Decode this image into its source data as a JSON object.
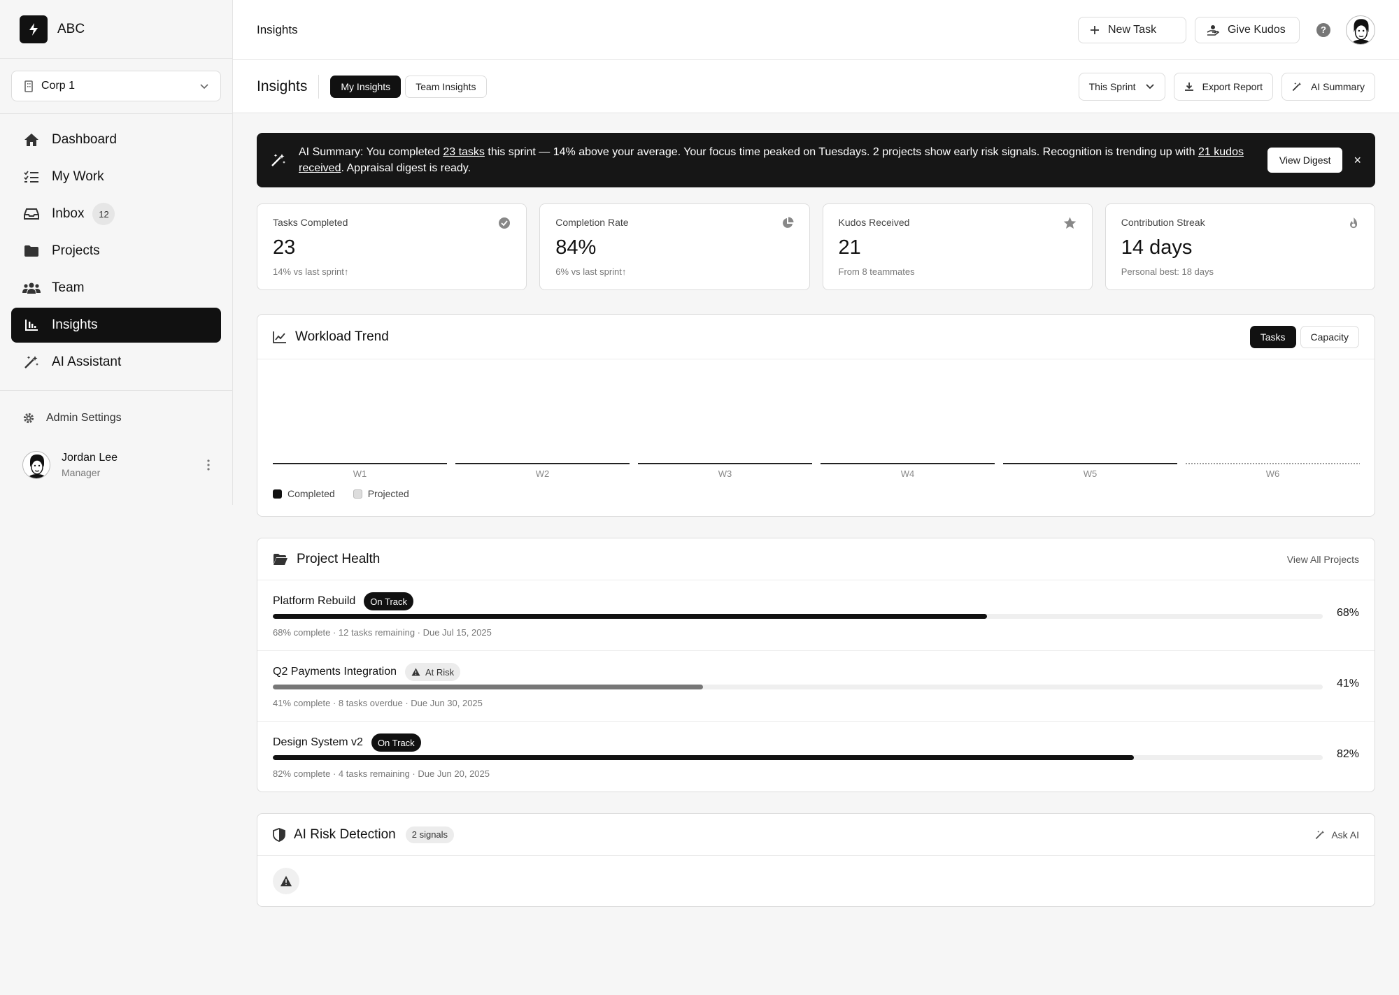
{
  "app": {
    "name": "ABC"
  },
  "org": {
    "name": "Corp 1"
  },
  "nav": [
    {
      "label": "Dashboard",
      "icon": "home-icon"
    },
    {
      "label": "My Work",
      "icon": "checklist-icon"
    },
    {
      "label": "Inbox",
      "icon": "inbox-icon",
      "badge": "12"
    },
    {
      "label": "Projects",
      "icon": "folder-icon"
    },
    {
      "label": "Team",
      "icon": "team-icon"
    },
    {
      "label": "Insights",
      "icon": "chart-icon",
      "active": true
    },
    {
      "label": "AI Assistant",
      "icon": "magic-wand-icon"
    }
  ],
  "admin": {
    "label": "Admin Settings"
  },
  "user": {
    "name": "Jordan Lee",
    "role": "Manager"
  },
  "topbar": {
    "title": "Insights",
    "new_task": "New Task",
    "give_kudos": "Give Kudos",
    "help": "?"
  },
  "subbar": {
    "title": "Insights",
    "tabs": [
      "My Insights",
      "Team Insights"
    ],
    "period": "This Sprint",
    "export": "Export Report",
    "ai_summary": "AI Summary"
  },
  "banner": {
    "prefix": "AI Summary: You completed ",
    "link1": "23 tasks",
    "middle": " this sprint — 14% above your average. Your focus time peaked on Tuesdays. 2 projects show early risk signals. Recognition is trending up with ",
    "link2": "21 kudos received",
    "suffix": ". Appraisal digest is ready.",
    "button": "View Digest",
    "close": "×"
  },
  "stats": [
    {
      "label": "Tasks Completed",
      "value": "23",
      "sub": "14% vs last sprint↑",
      "icon": "check-circle-icon"
    },
    {
      "label": "Completion Rate",
      "value": "84%",
      "sub": "6% vs last sprint↑",
      "icon": "pie-icon"
    },
    {
      "label": "Kudos Received",
      "value": "21",
      "sub": "From 8 teammates",
      "icon": "star-icon"
    },
    {
      "label": "Contribution Streak",
      "value": "14 days",
      "sub": "Personal best: 18 days",
      "icon": "flame-icon"
    }
  ],
  "workload": {
    "title": "Workload Trend",
    "toggles": [
      "Tasks",
      "Capacity"
    ],
    "legend": [
      "Completed",
      "Projected"
    ]
  },
  "chart_data": {
    "type": "bar",
    "categories": [
      "W1",
      "W2",
      "W3",
      "W4",
      "W5",
      "W6"
    ],
    "series": [
      {
        "name": "Completed",
        "values": [
          0,
          0,
          0,
          0,
          0,
          null
        ]
      },
      {
        "name": "Projected",
        "values": [
          null,
          null,
          null,
          null,
          null,
          0
        ]
      }
    ],
    "title": "Workload Trend",
    "xlabel": "",
    "ylabel": "",
    "legend": "bottom-left",
    "grid": false
  },
  "health": {
    "title": "Project Health",
    "view_all": "View All Projects",
    "projects": [
      {
        "name": "Platform Rebuild",
        "status": "On Track",
        "progress": 68,
        "pct": "68%",
        "meta": "68% complete · 12 tasks remaining · Due Jul 15, 2025",
        "color": "#111111"
      },
      {
        "name": "Q2 Payments Integration",
        "status": "At Risk",
        "progress": 41,
        "pct": "41%",
        "meta": "41% complete · 8 tasks overdue · Due Jun 30, 2025",
        "color": "#777777"
      },
      {
        "name": "Design System v2",
        "status": "On Track",
        "progress": 82,
        "pct": "82%",
        "meta": "82% complete · 4 tasks remaining · Due Jun 20, 2025",
        "color": "#111111"
      }
    ]
  },
  "risk": {
    "title": "AI Risk Detection",
    "count": "2 signals",
    "ask": "Ask AI"
  }
}
